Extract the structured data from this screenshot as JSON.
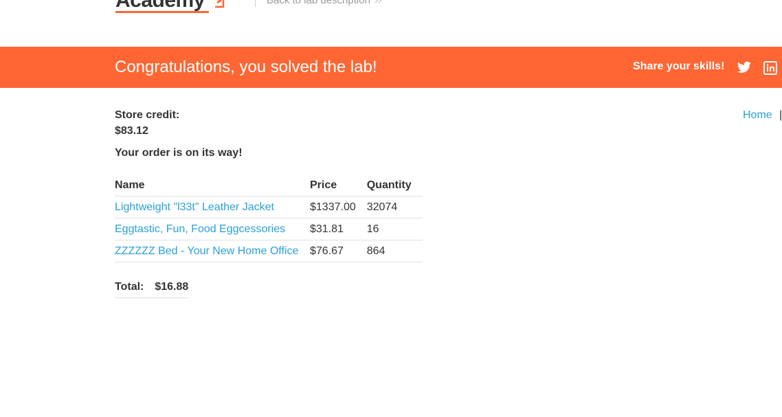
{
  "header": {
    "logo_text": "Academy",
    "back_link": "Back to lab description"
  },
  "banner": {
    "title": "Congratulations, you solved the lab!",
    "share_label": "Share your skills!",
    "icons": [
      "twitter-icon",
      "linkedin-icon"
    ],
    "background": "#ff6633"
  },
  "account": {
    "store_credit_label": "Store credit:",
    "store_credit_value": "$83.12",
    "order_message": "Your order is on its way!"
  },
  "nav": {
    "home": "Home",
    "separator": "|"
  },
  "order": {
    "headers": [
      "Name",
      "Price",
      "Quantity"
    ],
    "rows": [
      {
        "name": "Lightweight \"l33t\" Leather Jacket",
        "price": "$1337.00",
        "quantity": "32074"
      },
      {
        "name": "Eggtastic, Fun, Food Eggcessories",
        "price": "$31.81",
        "quantity": "16"
      },
      {
        "name": "ZZZZZZ Bed - Your New Home Office",
        "price": "$76.67",
        "quantity": "864"
      }
    ]
  },
  "total": {
    "label": "Total:",
    "value": "$16.88"
  },
  "colors": {
    "accent": "#ff6633",
    "link": "#29a0d9",
    "text": "#333333"
  }
}
